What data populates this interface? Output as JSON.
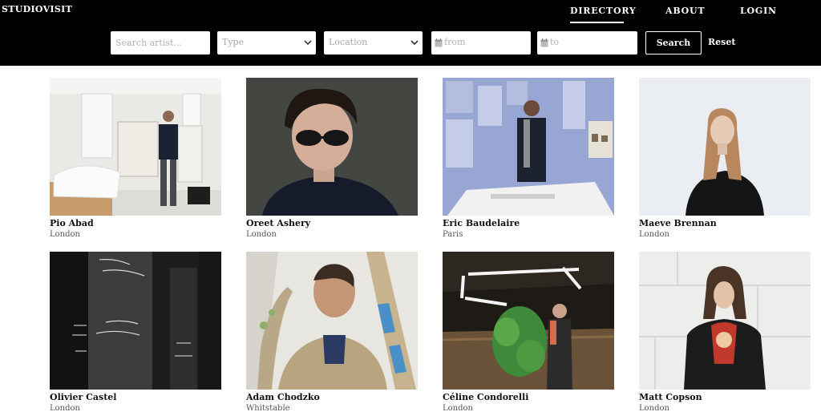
{
  "site": {
    "logo": "STUDIOVISIT"
  },
  "nav": {
    "directory": "DIRECTORY",
    "about": "ABOUT",
    "login": "LOGIN"
  },
  "filters": {
    "search_placeholder": "Search artist...",
    "type_label": "Type",
    "location_label": "Location",
    "from_label": "from",
    "to_label": "to",
    "search_button": "Search",
    "reset_button": "Reset"
  },
  "artists": [
    {
      "name": "Pio Abad",
      "city": "London"
    },
    {
      "name": "Oreet Ashery",
      "city": "London"
    },
    {
      "name": "Eric Baudelaire",
      "city": "Paris"
    },
    {
      "name": "Maeve Brennan",
      "city": "London"
    },
    {
      "name": "Olivier Castel",
      "city": "London"
    },
    {
      "name": "Adam Chodzko",
      "city": "Whitstable"
    },
    {
      "name": "Céline Condorelli",
      "city": "London"
    },
    {
      "name": "Matt Copson",
      "city": "London"
    }
  ],
  "colors": {
    "header_bg": "#000000",
    "page_bg": "#ffffff",
    "accent": "#ffffff"
  }
}
